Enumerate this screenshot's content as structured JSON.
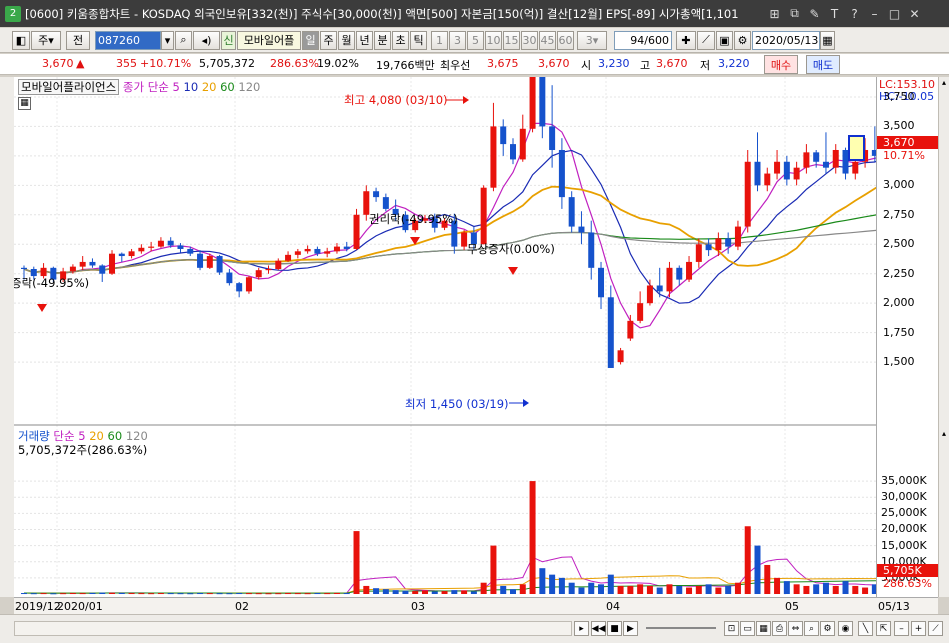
{
  "window": {
    "badge": "2",
    "title": "[0600] 키움종합차트 - KOSDAQ 외국인보유[332(천)] 주식수[30,000(천)] 액면[500] 자본금[150(억)] 결산[12월] EPS[-89] 시가총액[1,101"
  },
  "toolbar": {
    "period_unit": "주",
    "prev_label": "전",
    "code": "087260",
    "tag": "신",
    "stock_name": "모바일어플",
    "tf": [
      "일",
      "주",
      "월",
      "년",
      "분",
      "초",
      "틱"
    ],
    "nums": [
      "1",
      "3",
      "5",
      "10",
      "15",
      "30",
      "45",
      "60"
    ],
    "combo": "3",
    "count": "94/600",
    "date": "2020/05/13"
  },
  "quote": {
    "price": "3,670",
    "arrow": "▲",
    "change": "355",
    "rate": "+10.71%",
    "volume": "5,705,372",
    "vol_rate": "286.63%",
    "turnover": "19.02%",
    "amount": "19,766백만",
    "best_label": "최우선",
    "best1": "3,675",
    "best2": "3,670",
    "open_label": "시",
    "open": "3,230",
    "high_label": "고",
    "high": "3,670",
    "low_label": "저",
    "low": "3,220",
    "buy": "매수",
    "sell": "매도"
  },
  "price_legend": {
    "name": "모바일어플라이언스",
    "indicator": "종가 단순",
    "p5": "5",
    "p10": "10",
    "p20": "20",
    "p60": "60",
    "p120": "120"
  },
  "volume_legend": {
    "name": "거래량",
    "indicator": "단순",
    "p5": "5",
    "p20": "20",
    "p60": "60",
    "p120": "120",
    "value": "5,705,372주(286.63%)"
  },
  "annotations": {
    "high": "최고 4,080 (03/10)",
    "low": "최저 1,450 (03/19)",
    "rights": "권리락(-49.95%)",
    "bonus": "무상증자(0.00%)",
    "left": "증락(-49.95%)"
  },
  "right_labels": {
    "lc": "LC:153.10",
    "hc": "HC:-10.05",
    "price": "3,670",
    "pct": "10.71%",
    "vol": "5,705K",
    "vol_pct": "286.63%"
  },
  "colors": {
    "up": "#e8120c",
    "down": "#1552cc",
    "ma5": "#c020c0",
    "ma10": "#1a2bb4",
    "ma20": "#e8a000",
    "ma60": "#1a8a1a",
    "ma120": "#888888"
  },
  "chart_data": [
    {
      "type": "candlestick",
      "title": "모바일어플라이언스",
      "price_axis_ticks": [
        1500,
        1750,
        2000,
        2250,
        2500,
        2750,
        3000,
        3250,
        3500,
        3750
      ],
      "x_labels": [
        "2019/12",
        "2020/01",
        "02",
        "03",
        "04",
        "05",
        "05/13"
      ],
      "candles": [
        [
          2300,
          2290,
          2200,
          2320
        ],
        [
          2290,
          2230,
          2200,
          2310
        ],
        [
          2230,
          2300,
          2210,
          2340
        ],
        [
          2300,
          2200,
          2180,
          2310
        ],
        [
          2200,
          2270,
          2180,
          2300
        ],
        [
          2270,
          2310,
          2250,
          2330
        ],
        [
          2310,
          2350,
          2280,
          2400
        ],
        [
          2350,
          2320,
          2300,
          2380
        ],
        [
          2320,
          2250,
          2180,
          2330
        ],
        [
          2250,
          2420,
          2240,
          2450
        ],
        [
          2420,
          2400,
          2350,
          2430
        ],
        [
          2400,
          2440,
          2380,
          2460
        ],
        [
          2440,
          2470,
          2420,
          2500
        ],
        [
          2470,
          2480,
          2440,
          2520
        ],
        [
          2480,
          2530,
          2470,
          2560
        ],
        [
          2530,
          2490,
          2470,
          2560
        ],
        [
          2490,
          2460,
          2430,
          2510
        ],
        [
          2460,
          2420,
          2400,
          2480
        ],
        [
          2420,
          2300,
          2280,
          2450
        ],
        [
          2300,
          2400,
          2290,
          2420
        ],
        [
          2400,
          2260,
          2240,
          2410
        ],
        [
          2260,
          2170,
          2150,
          2290
        ],
        [
          2170,
          2100,
          2050,
          2180
        ],
        [
          2100,
          2220,
          2080,
          2230
        ],
        [
          2220,
          2280,
          2200,
          2300
        ],
        [
          2280,
          2290,
          2250,
          2320
        ],
        [
          2290,
          2360,
          2280,
          2380
        ],
        [
          2360,
          2410,
          2350,
          2440
        ],
        [
          2410,
          2440,
          2380,
          2460
        ],
        [
          2440,
          2460,
          2420,
          2490
        ],
        [
          2460,
          2420,
          2400,
          2480
        ],
        [
          2420,
          2440,
          2390,
          2470
        ],
        [
          2440,
          2480,
          2420,
          2510
        ],
        [
          2480,
          2460,
          2440,
          2520
        ],
        [
          2460,
          2750,
          2450,
          2800
        ],
        [
          2750,
          2950,
          2700,
          3000
        ],
        [
          2950,
          2900,
          2860,
          2980
        ],
        [
          2900,
          2800,
          2780,
          2930
        ],
        [
          2800,
          2750,
          2700,
          2880
        ],
        [
          2750,
          2620,
          2600,
          2780
        ],
        [
          2620,
          2700,
          2600,
          2720
        ],
        [
          2700,
          2720,
          2680,
          2750
        ],
        [
          2720,
          2640,
          2600,
          2760
        ],
        [
          2640,
          2700,
          2620,
          2720
        ],
        [
          2700,
          2480,
          2420,
          2760
        ],
        [
          2480,
          2600,
          2450,
          2620
        ],
        [
          2600,
          2500,
          2450,
          2650
        ],
        [
          2500,
          2980,
          2500,
          3000
        ],
        [
          2980,
          3500,
          2950,
          3700
        ],
        [
          3500,
          3350,
          3250,
          3560
        ],
        [
          3350,
          3220,
          3180,
          3400
        ],
        [
          3220,
          3480,
          3200,
          3600
        ],
        [
          3480,
          4080,
          3450,
          4100
        ],
        [
          4080,
          3500,
          3400,
          3900
        ],
        [
          3500,
          3300,
          3150,
          3850
        ],
        [
          3300,
          2900,
          2800,
          3400
        ],
        [
          2900,
          2650,
          2600,
          2950
        ],
        [
          2650,
          2600,
          2500,
          2780
        ],
        [
          2600,
          2300,
          2200,
          2700
        ],
        [
          2300,
          2050,
          1950,
          2350
        ],
        [
          2050,
          1450,
          1450,
          2150
        ],
        [
          1500,
          1600,
          1480,
          1620
        ],
        [
          1700,
          1850,
          1680,
          1900
        ],
        [
          1850,
          2000,
          1830,
          2100
        ],
        [
          2000,
          2150,
          1980,
          2200
        ],
        [
          2150,
          2100,
          2050,
          2300
        ],
        [
          2100,
          2300,
          2050,
          2350
        ],
        [
          2300,
          2200,
          2150,
          2320
        ],
        [
          2200,
          2350,
          2180,
          2400
        ],
        [
          2350,
          2500,
          2300,
          2550
        ],
        [
          2500,
          2450,
          2400,
          2550
        ],
        [
          2450,
          2550,
          2400,
          2600
        ],
        [
          2550,
          2480,
          2420,
          2600
        ],
        [
          2480,
          2650,
          2450,
          2700
        ],
        [
          2650,
          3200,
          2600,
          3300
        ],
        [
          3200,
          3000,
          2950,
          3450
        ],
        [
          3000,
          3100,
          2950,
          3150
        ],
        [
          3100,
          3200,
          3050,
          3300
        ],
        [
          3200,
          3050,
          3000,
          3250
        ],
        [
          3050,
          3150,
          3000,
          3200
        ],
        [
          3150,
          3280,
          3100,
          3350
        ],
        [
          3280,
          3200,
          3150,
          3300
        ],
        [
          3200,
          3150,
          3100,
          3450
        ],
        [
          3150,
          3300,
          3100,
          3350
        ],
        [
          3300,
          3100,
          3050,
          3320
        ],
        [
          3100,
          3200,
          3050,
          3250
        ],
        [
          3200,
          3300,
          3150,
          3400
        ],
        [
          3300,
          3250,
          3200,
          3500
        ],
        [
          3250,
          3400,
          3200,
          3450
        ],
        [
          3400,
          3150,
          3100,
          3450
        ],
        [
          3150,
          3250,
          3100,
          3280
        ],
        [
          3250,
          3300,
          3200,
          3350
        ],
        [
          3300,
          3350,
          3250,
          3380
        ],
        [
          3300,
          3310,
          3250,
          3380
        ],
        [
          3230,
          3670,
          3220,
          3670
        ]
      ],
      "volume_axis_ticks": [
        5000,
        10000,
        15000,
        20000,
        25000,
        30000,
        35000
      ],
      "volumes": [
        300,
        250,
        280,
        220,
        260,
        300,
        280,
        350,
        420,
        380,
        330,
        300,
        280,
        260,
        300,
        280,
        260,
        240,
        300,
        280,
        260,
        250,
        300,
        280,
        260,
        240,
        260,
        300,
        280,
        260,
        300,
        280,
        320,
        300,
        19500,
        2500,
        1800,
        1500,
        1200,
        1000,
        900,
        1100,
        800,
        900,
        1200,
        1100,
        800,
        3500,
        15000,
        2500,
        1500,
        3000,
        35000,
        8000,
        6000,
        5000,
        3500,
        2000,
        3500,
        3000,
        6000,
        2500,
        2500,
        3000,
        2500,
        2000,
        3000,
        2500,
        2000,
        2500,
        3000,
        2000,
        2500,
        3500,
        21000,
        15000,
        9000,
        5000,
        4000,
        3000,
        2500,
        3000,
        3500,
        2500,
        4000,
        2500,
        2000,
        3000,
        4500,
        17500,
        9000,
        2000,
        1800,
        2500,
        5705
      ]
    }
  ]
}
